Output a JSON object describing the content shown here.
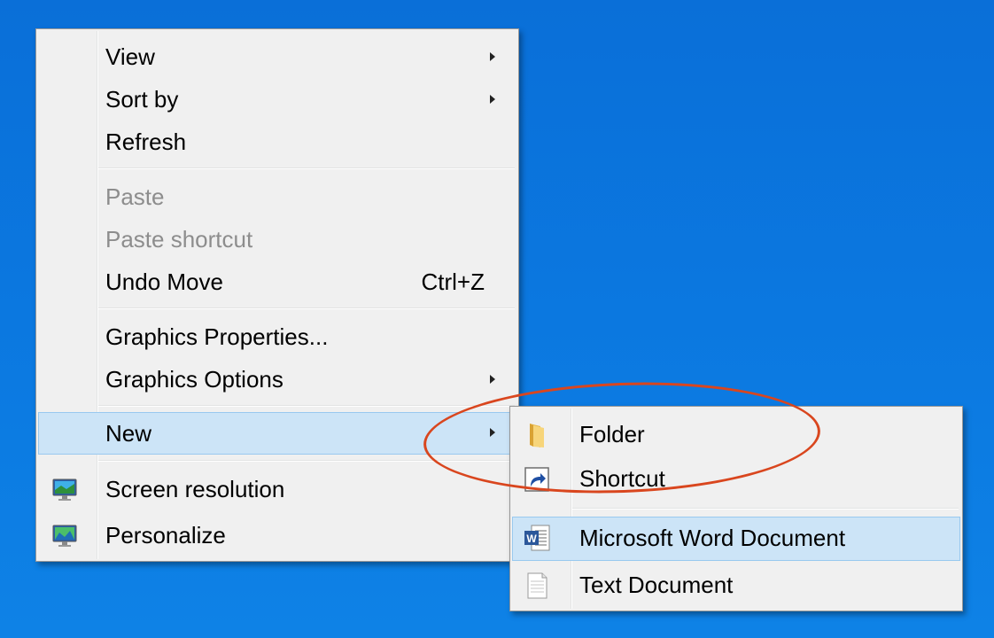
{
  "context_menu": {
    "items": [
      {
        "label": "View",
        "submenu": true
      },
      {
        "label": "Sort by",
        "submenu": true
      },
      {
        "label": "Refresh"
      },
      {
        "label": "Paste",
        "disabled": true
      },
      {
        "label": "Paste shortcut",
        "disabled": true
      },
      {
        "label": "Undo Move",
        "shortcut": "Ctrl+Z"
      },
      {
        "label": "Graphics Properties..."
      },
      {
        "label": "Graphics Options",
        "submenu": true
      },
      {
        "label": "New",
        "submenu": true,
        "highlighted": true
      },
      {
        "label": "Screen resolution",
        "icon": "screen-resolution-icon"
      },
      {
        "label": "Personalize",
        "icon": "personalize-icon"
      }
    ]
  },
  "new_submenu": {
    "items": [
      {
        "label": "Folder",
        "icon": "folder-icon"
      },
      {
        "label": "Shortcut",
        "icon": "shortcut-icon"
      },
      {
        "label": "Microsoft Word Document",
        "icon": "word-document-icon",
        "highlighted": true
      },
      {
        "label": "Text Document",
        "icon": "text-document-icon"
      }
    ]
  },
  "colors": {
    "desktop": "#0b78e0",
    "menu_bg": "#f0f0f0",
    "hover_bg": "#cce4f7",
    "annotation_circle": "#d9461e"
  }
}
